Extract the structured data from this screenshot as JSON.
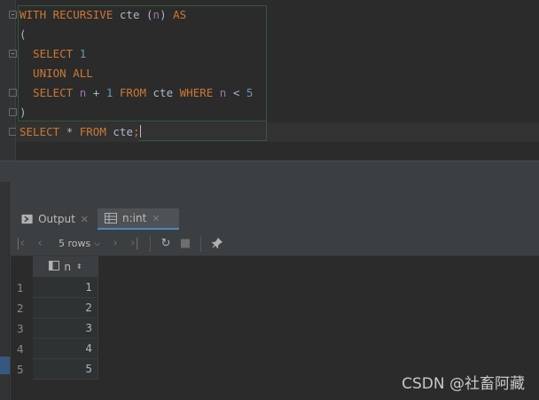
{
  "editor": {
    "lines": [
      [
        {
          "t": "WITH RECURSIVE ",
          "c": "kw"
        },
        {
          "t": "cte ",
          "c": "plain"
        },
        {
          "t": "(",
          "c": "plain"
        },
        {
          "t": "n",
          "c": "par"
        },
        {
          "t": ") ",
          "c": "plain"
        },
        {
          "t": "AS",
          "c": "kw"
        }
      ],
      [
        {
          "t": "(",
          "c": "plain"
        }
      ],
      [
        {
          "t": "  SELECT ",
          "c": "kw"
        },
        {
          "t": "1",
          "c": "num"
        }
      ],
      [
        {
          "t": "  UNION ALL",
          "c": "kw"
        }
      ],
      [
        {
          "t": "  SELECT ",
          "c": "kw"
        },
        {
          "t": "n",
          "c": "par"
        },
        {
          "t": " + ",
          "c": "plain"
        },
        {
          "t": "1",
          "c": "num"
        },
        {
          "t": " FROM ",
          "c": "kw"
        },
        {
          "t": "cte ",
          "c": "plain"
        },
        {
          "t": "WHERE ",
          "c": "kw"
        },
        {
          "t": "n",
          "c": "par"
        },
        {
          "t": " < ",
          "c": "plain"
        },
        {
          "t": "5",
          "c": "num"
        }
      ],
      [
        {
          "t": ")",
          "c": "plain"
        }
      ],
      [
        {
          "t": "SELECT ",
          "c": "kw"
        },
        {
          "t": "* ",
          "c": "plain"
        },
        {
          "t": "FROM ",
          "c": "kw"
        },
        {
          "t": "cte",
          "c": "plain"
        },
        {
          "t": ";",
          "c": "kw"
        }
      ]
    ]
  },
  "tabs": [
    {
      "label": "Output",
      "icon": "console-icon",
      "active": false
    },
    {
      "label": "n:int",
      "icon": "table-icon",
      "active": true
    }
  ],
  "toolbar": {
    "rows_label": "5 rows"
  },
  "grid": {
    "column": "n",
    "rows": [
      {
        "num": "1",
        "value": "1"
      },
      {
        "num": "2",
        "value": "2"
      },
      {
        "num": "3",
        "value": "3"
      },
      {
        "num": "4",
        "value": "4"
      },
      {
        "num": "5",
        "value": "5"
      }
    ]
  },
  "watermark": "CSDN @社畜阿藏",
  "colors": {
    "keyword": "#cc7832",
    "number": "#6897bb",
    "param": "#9876aa",
    "text": "#a9b7c6",
    "accent": "#4a88c7"
  }
}
